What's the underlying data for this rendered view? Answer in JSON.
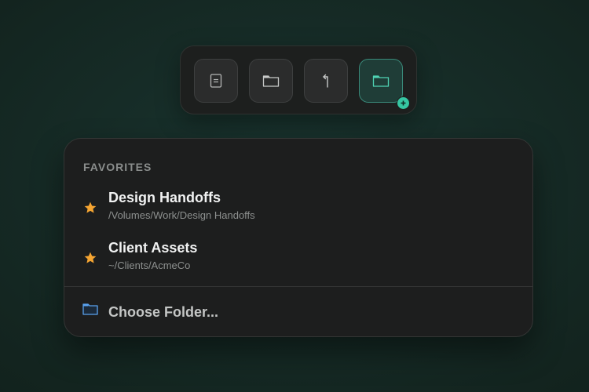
{
  "toolbar": {
    "buttons": [
      {
        "icon": "document-icon",
        "active": false
      },
      {
        "icon": "folder-icon",
        "active": false
      },
      {
        "icon": "back-arrow-icon",
        "active": false
      },
      {
        "icon": "folder-add-icon",
        "active": true,
        "badge": "plus-badge-icon"
      }
    ]
  },
  "favorites": {
    "title": "FAVORITES",
    "items": [
      {
        "name": "Design Handoffs",
        "path": "/Volumes/Work/Design Handoffs",
        "icon": "star-icon"
      },
      {
        "name": "Client Assets",
        "path": "~/Clients/AcmeCo",
        "icon": "star-icon"
      }
    ]
  },
  "choose": {
    "label": "Choose Folder...",
    "icon": "folder-icon"
  },
  "colors": {
    "accent": "#36c6a2",
    "star": "#f5a532",
    "folder_blue": "#5aa2ef"
  }
}
